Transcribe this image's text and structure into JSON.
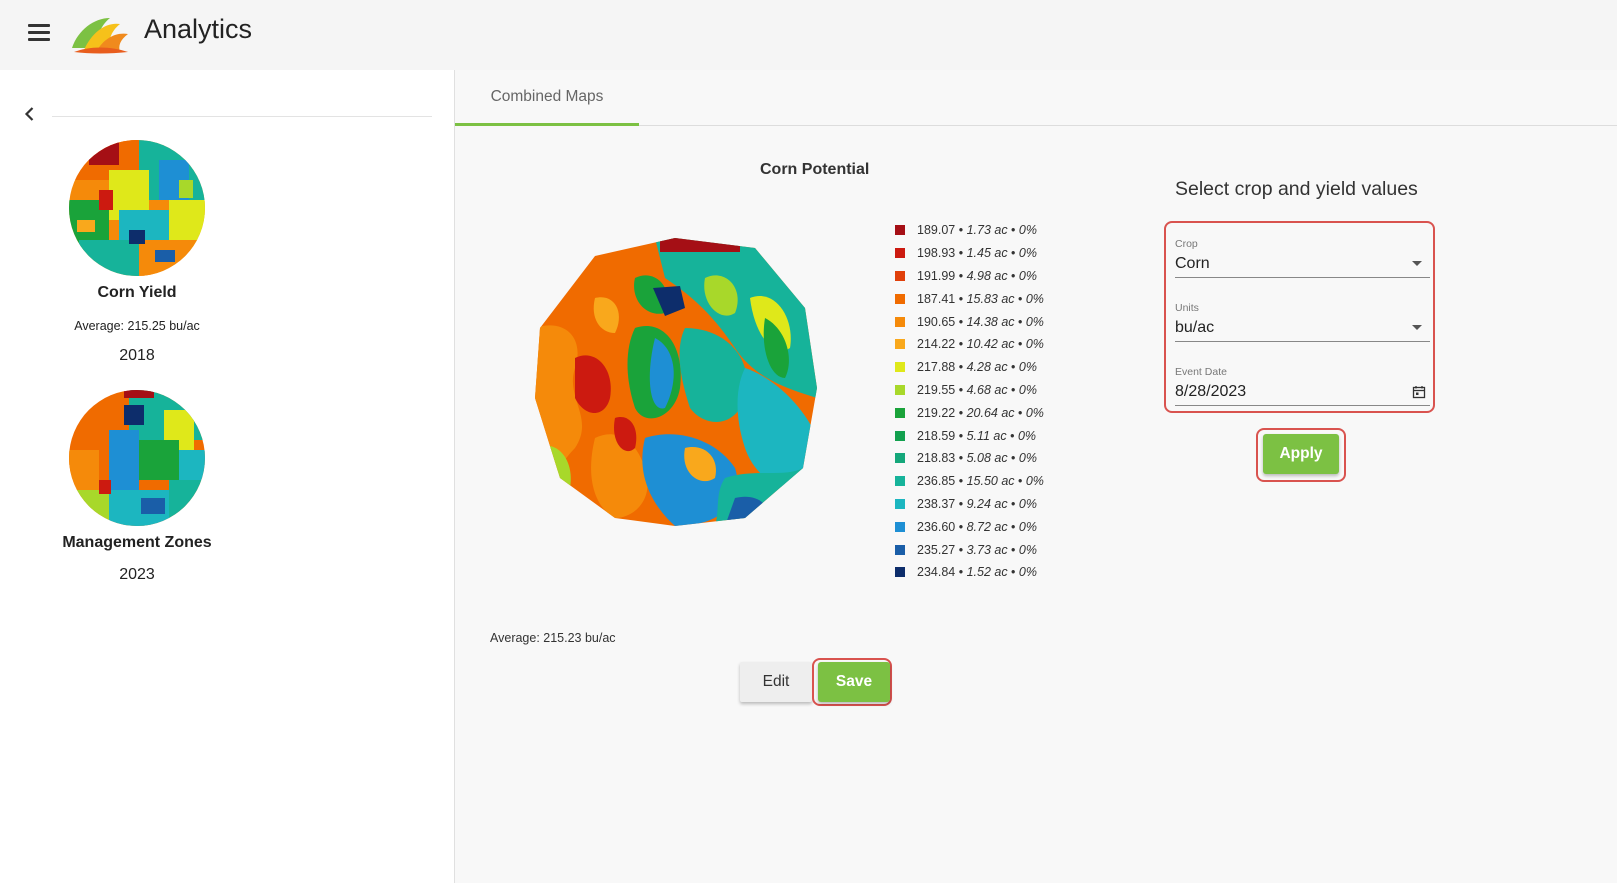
{
  "header": {
    "title": "Analytics"
  },
  "sidebar": {
    "cards": [
      {
        "title": "Corn Yield",
        "average": "Average: 215.25 bu/ac",
        "year": "2018"
      },
      {
        "title": "Management Zones",
        "average": "",
        "year": "2023"
      }
    ]
  },
  "tabs": [
    {
      "label": "Combined Maps"
    }
  ],
  "map": {
    "title": "Corn Potential",
    "average": "Average: 215.23 bu/ac",
    "legend": [
      {
        "value": "189.07",
        "acres": "1.73 ac",
        "pct": "0%",
        "color": "#a50f15"
      },
      {
        "value": "198.93",
        "acres": "1.45 ac",
        "pct": "0%",
        "color": "#cc1a10"
      },
      {
        "value": "191.99",
        "acres": "4.98 ac",
        "pct": "0%",
        "color": "#e0400a"
      },
      {
        "value": "187.41",
        "acres": "15.83 ac",
        "pct": "0%",
        "color": "#f06b00"
      },
      {
        "value": "190.65",
        "acres": "14.38 ac",
        "pct": "0%",
        "color": "#f58a0a"
      },
      {
        "value": "214.22",
        "acres": "10.42 ac",
        "pct": "0%",
        "color": "#f9a81c"
      },
      {
        "value": "217.88",
        "acres": "4.28 ac",
        "pct": "0%",
        "color": "#dfe81a"
      },
      {
        "value": "219.55",
        "acres": "4.68 ac",
        "pct": "0%",
        "color": "#a8d82a"
      },
      {
        "value": "219.22",
        "acres": "20.64 ac",
        "pct": "0%",
        "color": "#1aa33a"
      },
      {
        "value": "218.59",
        "acres": "5.11 ac",
        "pct": "0%",
        "color": "#12a04e"
      },
      {
        "value": "218.83",
        "acres": "5.08 ac",
        "pct": "0%",
        "color": "#14a77a"
      },
      {
        "value": "236.85",
        "acres": "15.50 ac",
        "pct": "0%",
        "color": "#16b39a"
      },
      {
        "value": "238.37",
        "acres": "9.24 ac",
        "pct": "0%",
        "color": "#1cb6c0"
      },
      {
        "value": "236.60",
        "acres": "8.72 ac",
        "pct": "0%",
        "color": "#1e8fd4"
      },
      {
        "value": "235.27",
        "acres": "3.73 ac",
        "pct": "0%",
        "color": "#1a5ea8"
      },
      {
        "value": "234.84",
        "acres": "1.52 ac",
        "pct": "0%",
        "color": "#0d2d6b"
      }
    ]
  },
  "buttons": {
    "edit": "Edit",
    "save": "Save",
    "apply": "Apply"
  },
  "form": {
    "heading": "Select crop and yield values",
    "crop_label": "Crop",
    "crop_value": "Corn",
    "units_label": "Units",
    "units_value": "bu/ac",
    "date_label": "Event Date",
    "date_value": "8/28/2023"
  },
  "colors": {
    "accent_green": "#7cc143",
    "highlight_red": "#d9534f"
  },
  "icons": [
    "hamburger-menu-icon",
    "app-logo-icon",
    "chevron-left-icon",
    "dropdown-caret-icon",
    "calendar-icon"
  ]
}
